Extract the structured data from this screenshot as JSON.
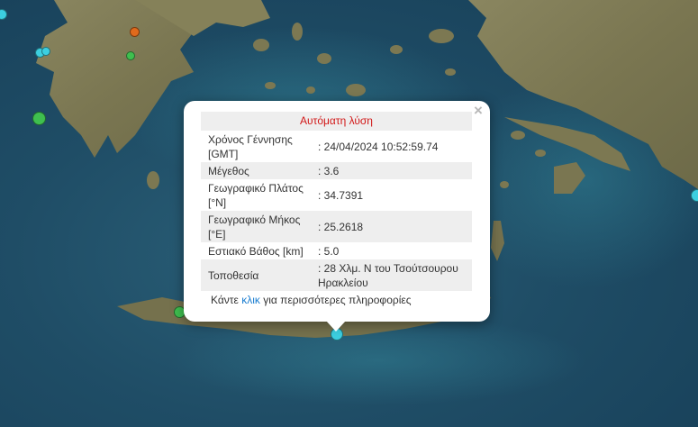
{
  "popup": {
    "title": "Αυτόματη λύση",
    "close_symbol": "×",
    "rows": [
      {
        "label": "Χρόνος Γέννησης [GMT]",
        "value": ": 24/04/2024 10:52:59.74"
      },
      {
        "label": "Μέγεθος",
        "value": ": 3.6"
      },
      {
        "label": "Γεωγραφικό Πλάτος [°N]",
        "value": ": 34.7391"
      },
      {
        "label": "Γεωγραφικό Μήκος [°E]",
        "value": ": 25.2618"
      },
      {
        "label": "Εστιακό Βάθος [km]",
        "value": ": 5.0"
      },
      {
        "label": "Τοποθεσία",
        "value": ": 28 Χλμ. Ν του Τσούτσουρου Ηρακλείου"
      }
    ],
    "more_prefix": "Κάντε ",
    "more_link": "κλικ",
    "more_suffix": " για περισσότερες πληροφορίες"
  },
  "colors": {
    "sea": "#1f4d66",
    "land": "#7d7a55",
    "marker_green": "#3fbf4f",
    "marker_cyan": "#3ccfe0",
    "marker_orange": "#e06a1c",
    "popup_title": "#d21818",
    "link": "#1a7dd0"
  },
  "markers": [
    {
      "name": "event-marker-orange",
      "color": "orange"
    },
    {
      "name": "event-marker-cyan",
      "color": "cyan"
    },
    {
      "name": "event-marker-cyan",
      "color": "cyan"
    },
    {
      "name": "event-marker-green",
      "color": "green"
    },
    {
      "name": "event-marker-green",
      "color": "green"
    },
    {
      "name": "event-marker-cyan",
      "color": "cyan"
    },
    {
      "name": "event-marker-green",
      "color": "green"
    },
    {
      "name": "event-marker-cyan-selected",
      "color": "cyan"
    },
    {
      "name": "event-marker-cyan",
      "color": "cyan"
    }
  ]
}
